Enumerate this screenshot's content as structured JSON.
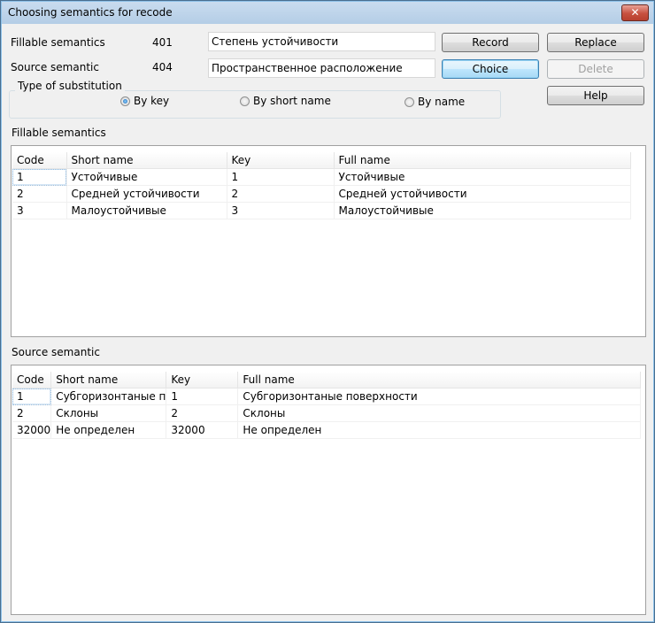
{
  "window": {
    "title": "Choosing semantics for recode",
    "close_label": "✕"
  },
  "header": {
    "fillable_label": "Fillable semantics",
    "fillable_code": "401",
    "fillable_value": "Степень устойчивости",
    "source_label": "Source semantic",
    "source_code": "404",
    "source_value": "Пространственное расположение"
  },
  "buttons": {
    "record": "Record",
    "replace": "Replace",
    "choice": "Choice",
    "delete": "Delete",
    "help": "Help"
  },
  "substitution": {
    "title": "Type of substitution",
    "options": [
      {
        "label": "By key",
        "selected": true
      },
      {
        "label": "By short name",
        "selected": false
      },
      {
        "label": "By name",
        "selected": false
      }
    ]
  },
  "fillable_table": {
    "title": "Fillable semantics",
    "columns": [
      "Code",
      "Short name",
      "Key",
      "Full name"
    ],
    "rows": [
      [
        "1",
        "Устойчивые",
        "1",
        "Устойчивые"
      ],
      [
        "2",
        "Средней устойчивости",
        "2",
        "Средней устойчивости"
      ],
      [
        "3",
        "Малоустойчивые",
        "3",
        "Малоустойчивые"
      ]
    ]
  },
  "source_table": {
    "title": "Source semantic",
    "columns": [
      "Code",
      "Short name",
      "Key",
      "Full name"
    ],
    "rows": [
      [
        "1",
        "Субгоризонтаные п",
        "1",
        "Субгоризонтаные поверхности"
      ],
      [
        "2",
        "Склоны",
        "2",
        "Склоны"
      ],
      [
        "32000",
        "Не определен",
        "32000",
        "Не определен"
      ]
    ]
  }
}
